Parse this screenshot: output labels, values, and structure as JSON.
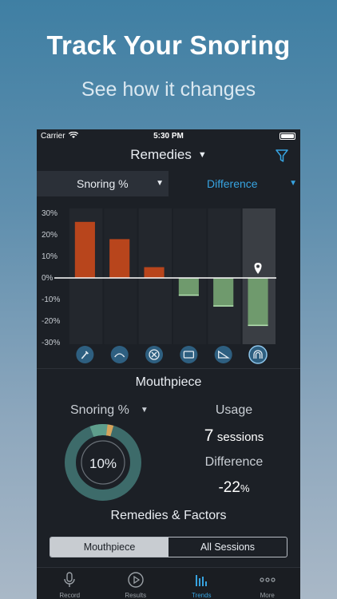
{
  "promo": {
    "headline": "Track Your Snoring",
    "subline": "See how it changes"
  },
  "status_bar": {
    "carrier": "Carrier",
    "time": "5:30 PM"
  },
  "nav": {
    "title": "Remedies"
  },
  "selectors": {
    "left": "Snoring %",
    "right": "Difference"
  },
  "chart_data": {
    "type": "bar",
    "categories": [
      "Mouth exercises",
      "Nasal strips",
      "No remedy",
      "Sleeping on side",
      "Wedge pillow",
      "Mouthpiece"
    ],
    "icon_names": [
      "spray-icon",
      "nasal-strips-icon",
      "no-remedy-icon",
      "pillow-icon",
      "wedge-icon",
      "mouthpiece-icon"
    ],
    "values": [
      26,
      18,
      5,
      -8,
      -13,
      -22
    ],
    "ylim": [
      -30,
      30
    ],
    "y_ticks": [
      "30%",
      "20%",
      "10%",
      "0%",
      "-10%",
      "-20%",
      "-30%"
    ],
    "selected_index": 5,
    "positive_color": "#b8451c",
    "negative_color": "#6f9a6d"
  },
  "detail": {
    "title": "Mouthpiece",
    "metric_label": "Snoring %",
    "snoring_percent_value": 10,
    "snoring_percent_display": "10%",
    "usage_label": "Usage",
    "usage_count": "7",
    "usage_unit": "sessions",
    "difference_label": "Difference",
    "difference_value": "-22",
    "difference_unit": "%",
    "section_title": "Remedies & Factors",
    "segment_options": [
      "Mouthpiece",
      "All Sessions"
    ],
    "segment_selected": "Mouthpiece"
  },
  "tabbar": {
    "items": [
      {
        "label": "Record",
        "icon": "microphone-icon"
      },
      {
        "label": "Results",
        "icon": "play-icon"
      },
      {
        "label": "Trends",
        "icon": "bar-chart-icon"
      },
      {
        "label": "More",
        "icon": "more-dots-icon"
      }
    ],
    "active": "Trends"
  },
  "colors": {
    "accent": "#37a3e0",
    "background": "#1c2026"
  }
}
